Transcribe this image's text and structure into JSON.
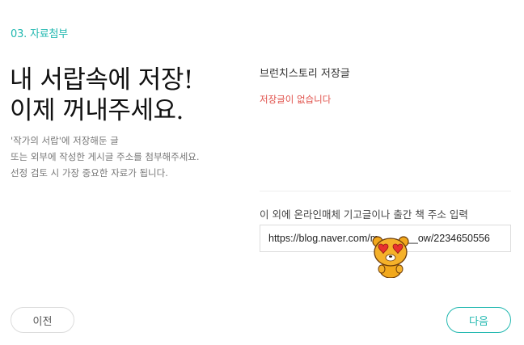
{
  "step": {
    "label": "03. 자료첨부"
  },
  "headline": {
    "line1": "내 서랍속에 저장!",
    "line2": "이제 꺼내주세요."
  },
  "description": {
    "line1": "'작가의 서랍'에 저장해둔 글",
    "line2": "또는 외부에 작성한 게시글 주소를 첨부해주세요.",
    "line3": "선정 검토 시 가장 중요한 자료가 됩니다."
  },
  "drawer": {
    "title": "브런치스토리 저장글",
    "empty_message": "저장글이 없습니다"
  },
  "external": {
    "label": "이 외에 온라인매체 기고글이나 출간 책 주소 입력",
    "url_value": "https://blog.naver.com/m_______ow/2234650556"
  },
  "buttons": {
    "prev": "이전",
    "next": "다음"
  },
  "sticker": {
    "icon": "bear-heart-eyes-sticker-icon"
  },
  "colors": {
    "accent": "#22b8b0",
    "error": "#e0504a"
  }
}
